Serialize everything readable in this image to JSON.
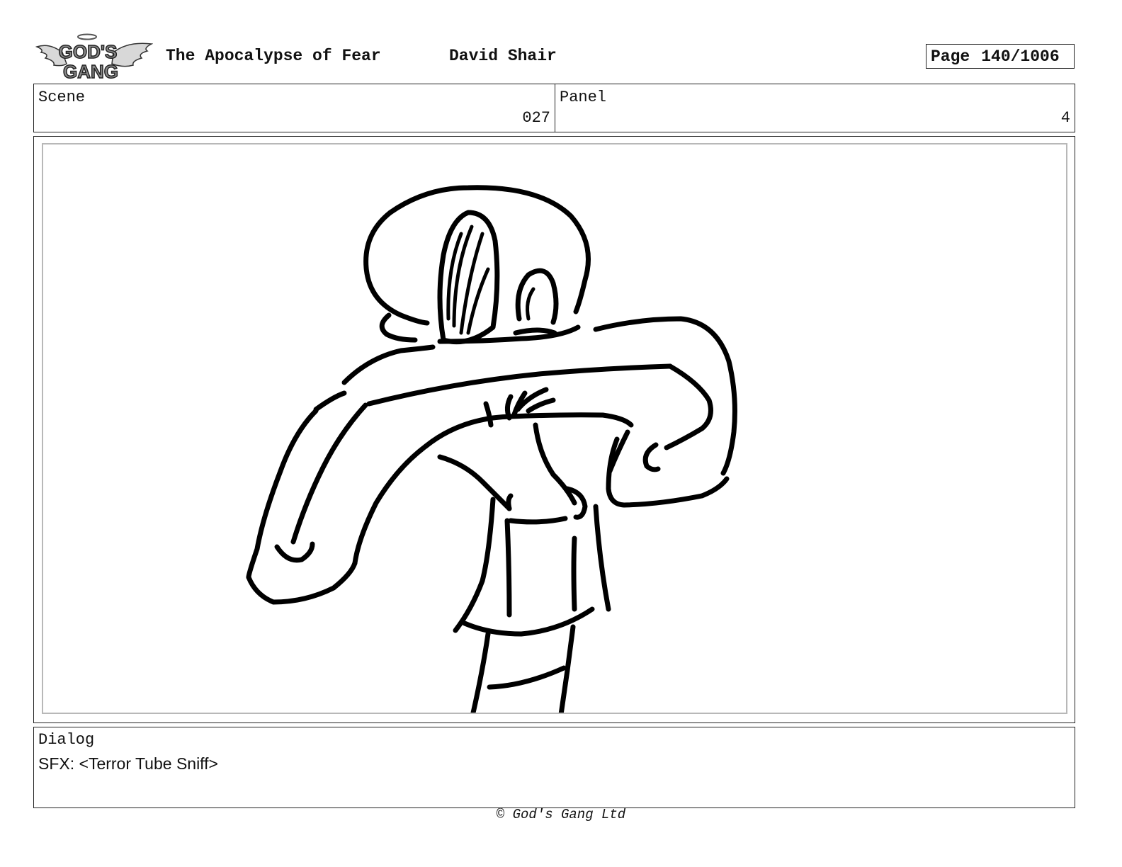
{
  "header": {
    "logo_name": "gods-gang-logo",
    "logo_text": "GOD'S GANG",
    "title": "The Apocalypse of Fear",
    "author": "David Shair",
    "page_label": "Page",
    "page_value": "140/1006"
  },
  "info": {
    "scene_label": "Scene",
    "scene_value": "027",
    "panel_label": "Panel",
    "panel_value": "4"
  },
  "frame": {
    "drawing_name": "storyboard-sketch"
  },
  "dialog": {
    "label": "Dialog",
    "text": "SFX: <Terror Tube Sniff>"
  },
  "footer": {
    "copyright": "© God's Gang Ltd"
  }
}
